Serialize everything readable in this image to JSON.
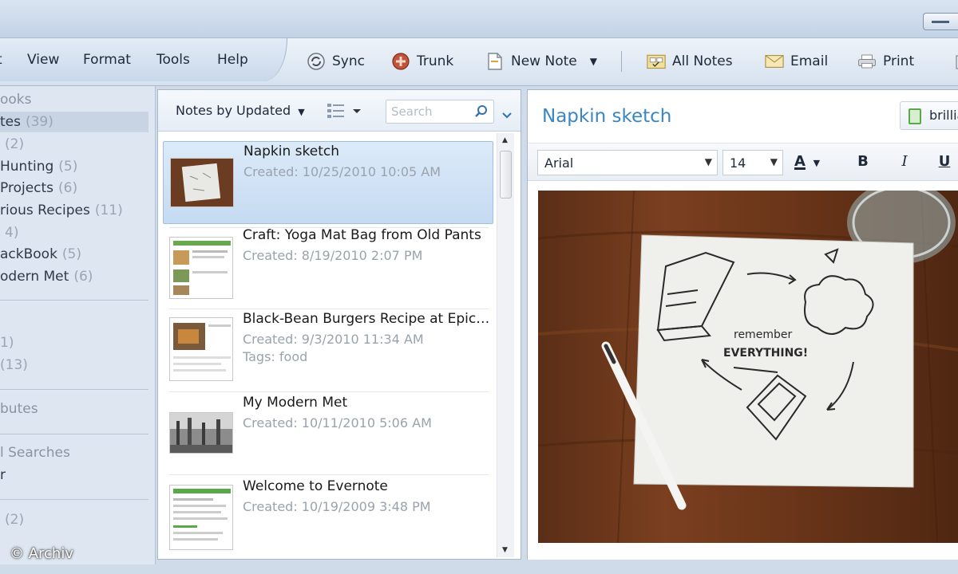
{
  "menu": {
    "items": [
      "t",
      "View",
      "Format",
      "Tools",
      "Help"
    ]
  },
  "toolbar": {
    "sync": "Sync",
    "trunk": "Trunk",
    "new_note": "New Note",
    "all_notes": "All Notes",
    "email": "Email",
    "print": "Print"
  },
  "sidebar": {
    "rows": [
      {
        "label": "ooks",
        "count": "",
        "style": "header"
      },
      {
        "label": "tes",
        "count": "(39)",
        "style": "selected"
      },
      {
        "label": "",
        "count": "(2)",
        "style": ""
      },
      {
        "label": "Hunting",
        "count": "(5)",
        "style": ""
      },
      {
        "label": "Projects",
        "count": "(6)",
        "style": ""
      },
      {
        "label": "rious Recipes",
        "count": "(11)",
        "style": ""
      },
      {
        "label": "",
        "count": "4)",
        "style": ""
      },
      {
        "label": "ackBook",
        "count": "(5)",
        "style": ""
      },
      {
        "label": "odern Met",
        "count": "(6)",
        "style": ""
      },
      {
        "label": "",
        "count": "1)",
        "style": ""
      },
      {
        "label": "",
        "count": "(13)",
        "style": ""
      },
      {
        "label": "butes",
        "count": "",
        "style": "header"
      },
      {
        "label": "l Searches",
        "count": "",
        "style": "header"
      },
      {
        "label": "r",
        "count": "",
        "style": ""
      },
      {
        "label": "",
        "count": "(2)",
        "style": ""
      }
    ],
    "watermark": "© Archiv"
  },
  "notelist": {
    "sort_label": "Notes by Updated",
    "search_placeholder": "Search",
    "notes": [
      {
        "title": "Napkin sketch",
        "created": "Created: 10/25/2010 10:05 AM",
        "tags": ""
      },
      {
        "title": "Craft: Yoga Mat Bag from Old Pants",
        "created": "Created: 8/19/2010 2:07 PM",
        "tags": ""
      },
      {
        "title": "Black-Bean Burgers Recipe at Epicuri…",
        "created": "Created: 9/3/2010 11:34 AM",
        "tags": "Tags: food"
      },
      {
        "title": "My Modern Met",
        "created": "Created: 10/11/2010 5:06 AM",
        "tags": ""
      },
      {
        "title": "Welcome to Evernote",
        "created": "Created: 10/19/2009 3:48 PM",
        "tags": ""
      }
    ]
  },
  "editor": {
    "title": "Napkin sketch",
    "notebook": "brillia",
    "font": "Arial",
    "size": "14",
    "bold": "B",
    "italic": "I",
    "underline": "U",
    "sketch_text_1": "remember",
    "sketch_text_2": "EVERYTHING!"
  },
  "colors": {
    "accent_title": "#3a86c4",
    "selection": "#c5dbf2",
    "sidebar_bg": "#dde6f1"
  }
}
